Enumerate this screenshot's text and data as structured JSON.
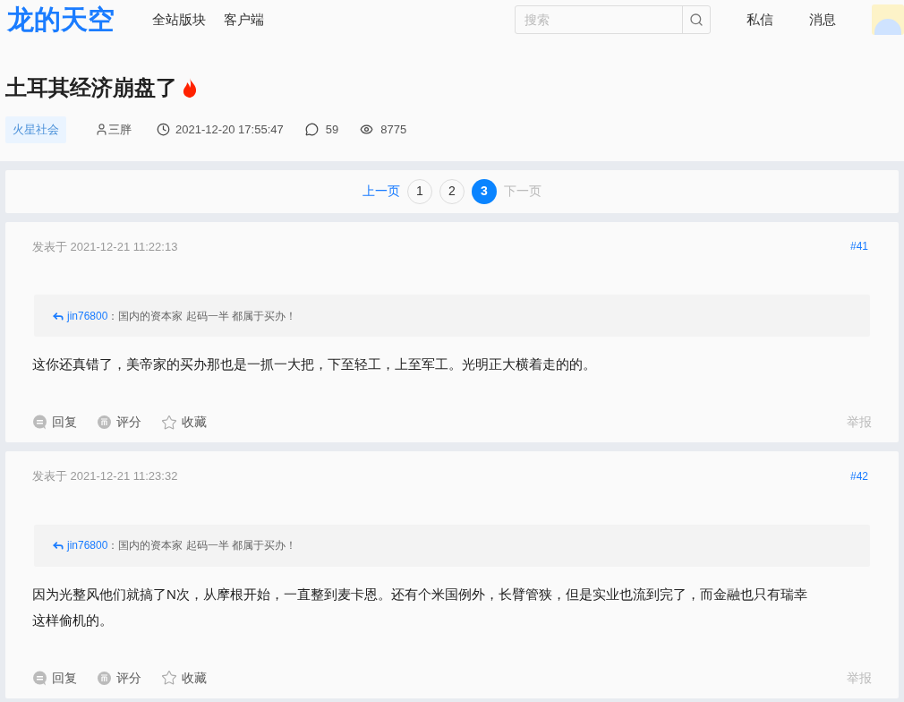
{
  "header": {
    "logo": "龙的天空",
    "nav": [
      "全站版块",
      "客户端"
    ],
    "search": {
      "placeholder": "搜索"
    },
    "links": [
      "私信",
      "消息"
    ]
  },
  "thread": {
    "title": "土耳其经济崩盘了",
    "hot": true,
    "tag": "火星社会",
    "author": "三胖",
    "time": "2021-12-20 17:55:47",
    "replies": "59",
    "views": "8775"
  },
  "pagination": [
    {
      "kind": "prev",
      "label": "上一页",
      "disabled": false
    },
    {
      "kind": "page",
      "label": "1",
      "selected": false
    },
    {
      "kind": "page",
      "label": "2",
      "selected": false
    },
    {
      "kind": "page",
      "label": "3",
      "selected": true
    },
    {
      "kind": "next",
      "label": "下一页",
      "disabled": true
    }
  ],
  "posts": [
    {
      "posted": "发表于 2021-12-21 11:22:13",
      "floor": "#41",
      "quote": {
        "user": "jin76800",
        "text": "：国内的资本家 起码一半 都属于买办！"
      },
      "body": "这你还真错了，美帝家的买办那也是一抓一大把，下至轻工，上至军工。光明正大横着走的的。",
      "actions": [
        {
          "kind": "reply",
          "label": "回复"
        },
        {
          "kind": "rate",
          "label": "评分"
        },
        {
          "kind": "favorite",
          "label": "收藏"
        }
      ],
      "report": "举报"
    },
    {
      "posted": "发表于 2021-12-21 11:23:32",
      "floor": "#42",
      "quote": {
        "user": "jin76800",
        "text": "：国内的资本家 起码一半 都属于买办！"
      },
      "body": "因为光整风他们就搞了N次，从摩根开始，一直整到麦卡恩。还有个米国例外，长臂管狭，但是实业也流到完了，而金融也只有瑞幸这样偷机的。",
      "actions": [
        {
          "kind": "reply",
          "label": "回复"
        },
        {
          "kind": "rate",
          "label": "评分"
        },
        {
          "kind": "favorite",
          "label": "收藏"
        }
      ],
      "report": "举报"
    }
  ]
}
